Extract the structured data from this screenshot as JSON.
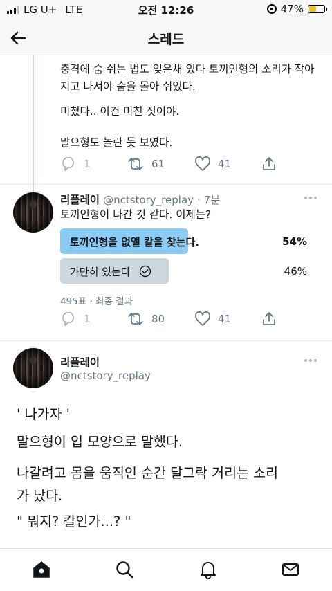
{
  "status_bar": {
    "carrier": "LG U+",
    "network": "LTE",
    "time": "오전 12:26",
    "battery": "47%",
    "battery_level": 0.47
  },
  "header": {
    "title": "스레드"
  },
  "tweet1": {
    "paragraphs": [
      "충격에 숨 쉬는 법도 잊은채 있다 토끼인형의 소리가 작아",
      "지고 나서야 숨을 몰아 쉬었다.",
      "미쳤다.. 이건 미친 짓이야.",
      "말으형도 놀란 듯 보였다."
    ],
    "replies": "1",
    "retweets": "61",
    "likes": "41"
  },
  "tweet2": {
    "name": "리플레이",
    "handle": "@nctstory_replay",
    "time": "· 7분",
    "text": "토끼인형이 나간 것 같다. 이제는?",
    "poll": {
      "options": [
        {
          "label": "토끼인형을 없앨 칼을 찾는다.",
          "percent": "54%",
          "fraction": 0.54,
          "winner": true,
          "color": "#8ccbf4"
        },
        {
          "label": "가만히 있는다",
          "percent": "46%",
          "fraction": 0.46,
          "winner": false,
          "color": "#ccd6dd"
        }
      ],
      "summary": "495표 · 최종 결과"
    },
    "replies": "1",
    "retweets": "80",
    "likes": "41"
  },
  "tweet3": {
    "name": "리플레이",
    "handle": "@nctstory_replay",
    "lines": [
      "' 나가자 '",
      "말으형이 입 모양으로 말했다.",
      "나갈려고 몸을 움직인 순간 달그락 거리는 소리",
      "가 났다.",
      "\" 뭐지? 칼인가...? \""
    ]
  },
  "tabbar": {
    "icons": [
      "home-icon",
      "search-icon",
      "notifications-icon",
      "messages-icon"
    ]
  }
}
